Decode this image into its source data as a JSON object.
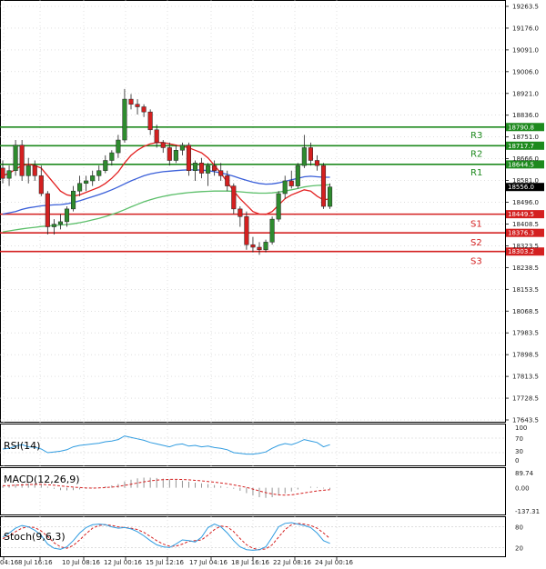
{
  "chart_data": {
    "type": "candlestick",
    "colors": {
      "up": "#2e8b2e",
      "down": "#d42020",
      "ma_fast": "#e32020",
      "ma_mid": "#3a5fd9",
      "ma_slow": "#5cbf6a",
      "support": "#d42020",
      "resistance": "#1e8a1e",
      "rsi": "#2e9be0",
      "macd_signal": "#d42020",
      "stoch_k": "#2e9be0",
      "stoch_d": "#d42020",
      "grid": "#cccccc"
    },
    "price_axis": {
      "ticks": [
        "19263.5",
        "19176.0",
        "19091.0",
        "19006.0",
        "18921.0",
        "18836.0",
        "18751.0",
        "18666.0",
        "18581.0",
        "18496.0",
        "18408.5",
        "18323.5",
        "18238.5",
        "18153.5",
        "18068.5",
        "17983.5",
        "17898.5",
        "17813.5",
        "17728.5",
        "17643.5"
      ],
      "range": [
        17643.5,
        19263.5
      ]
    },
    "x_axis": {
      "ticks": [
        "04:16",
        "8 Jul 16:16",
        "10 Jul 08:16",
        "12 Jul 00:16",
        "15 Jul 12:16",
        "17 Jul 04:16",
        "18 Jul 16:16",
        "22 Jul 08:16",
        "24 Jul 00:16"
      ]
    },
    "levels": [
      {
        "name": "R3",
        "value": 18790.8,
        "tag": "18790.8",
        "kind": "resistance"
      },
      {
        "name": "R2",
        "value": 18717.7,
        "tag": "18717.7",
        "kind": "resistance"
      },
      {
        "name": "R1",
        "value": 18644.5,
        "tag": "18644.5",
        "kind": "resistance"
      },
      {
        "name": "S1",
        "value": 18449.5,
        "tag": "18449.5",
        "kind": "support"
      },
      {
        "name": "S2",
        "value": 18376.3,
        "tag": "18376.3",
        "kind": "support"
      },
      {
        "name": "S3",
        "value": 18303.2,
        "tag": "18303.2",
        "kind": "support"
      }
    ],
    "current_price": {
      "value": 18556.0,
      "tag": "18556.0"
    },
    "candles": [
      {
        "o": 18630,
        "h": 18660,
        "l": 18570,
        "c": 18590
      },
      {
        "o": 18590,
        "h": 18640,
        "l": 18560,
        "c": 18620
      },
      {
        "o": 18620,
        "h": 18740,
        "l": 18600,
        "c": 18720
      },
      {
        "o": 18720,
        "h": 18740,
        "l": 18580,
        "c": 18600
      },
      {
        "o": 18600,
        "h": 18670,
        "l": 18570,
        "c": 18640
      },
      {
        "o": 18640,
        "h": 18660,
        "l": 18580,
        "c": 18600
      },
      {
        "o": 18600,
        "h": 18640,
        "l": 18520,
        "c": 18530
      },
      {
        "o": 18530,
        "h": 18540,
        "l": 18370,
        "c": 18400
      },
      {
        "o": 18400,
        "h": 18430,
        "l": 18370,
        "c": 18410
      },
      {
        "o": 18410,
        "h": 18450,
        "l": 18390,
        "c": 18420
      },
      {
        "o": 18420,
        "h": 18480,
        "l": 18400,
        "c": 18470
      },
      {
        "o": 18470,
        "h": 18560,
        "l": 18460,
        "c": 18540
      },
      {
        "o": 18540,
        "h": 18600,
        "l": 18520,
        "c": 18570
      },
      {
        "o": 18570,
        "h": 18600,
        "l": 18540,
        "c": 18580
      },
      {
        "o": 18580,
        "h": 18620,
        "l": 18560,
        "c": 18600
      },
      {
        "o": 18600,
        "h": 18640,
        "l": 18580,
        "c": 18620
      },
      {
        "o": 18620,
        "h": 18680,
        "l": 18610,
        "c": 18660
      },
      {
        "o": 18660,
        "h": 18700,
        "l": 18640,
        "c": 18690
      },
      {
        "o": 18690,
        "h": 18760,
        "l": 18670,
        "c": 18740
      },
      {
        "o": 18740,
        "h": 18940,
        "l": 18730,
        "c": 18900
      },
      {
        "o": 18900,
        "h": 18920,
        "l": 18860,
        "c": 18880
      },
      {
        "o": 18880,
        "h": 18900,
        "l": 18840,
        "c": 18870
      },
      {
        "o": 18870,
        "h": 18880,
        "l": 18830,
        "c": 18850
      },
      {
        "o": 18850,
        "h": 18860,
        "l": 18760,
        "c": 18780
      },
      {
        "o": 18780,
        "h": 18800,
        "l": 18710,
        "c": 18730
      },
      {
        "o": 18730,
        "h": 18740,
        "l": 18690,
        "c": 18710
      },
      {
        "o": 18710,
        "h": 18730,
        "l": 18640,
        "c": 18660
      },
      {
        "o": 18660,
        "h": 18720,
        "l": 18650,
        "c": 18700
      },
      {
        "o": 18700,
        "h": 18730,
        "l": 18680,
        "c": 18720
      },
      {
        "o": 18720,
        "h": 18730,
        "l": 18600,
        "c": 18620
      },
      {
        "o": 18620,
        "h": 18660,
        "l": 18580,
        "c": 18650
      },
      {
        "o": 18650,
        "h": 18670,
        "l": 18590,
        "c": 18610
      },
      {
        "o": 18610,
        "h": 18650,
        "l": 18560,
        "c": 18640
      },
      {
        "o": 18640,
        "h": 18660,
        "l": 18600,
        "c": 18620
      },
      {
        "o": 18620,
        "h": 18650,
        "l": 18580,
        "c": 18600
      },
      {
        "o": 18600,
        "h": 18620,
        "l": 18540,
        "c": 18560
      },
      {
        "o": 18560,
        "h": 18570,
        "l": 18450,
        "c": 18470
      },
      {
        "o": 18470,
        "h": 18480,
        "l": 18400,
        "c": 18440
      },
      {
        "o": 18440,
        "h": 18460,
        "l": 18310,
        "c": 18330
      },
      {
        "o": 18330,
        "h": 18360,
        "l": 18300,
        "c": 18320
      },
      {
        "o": 18320,
        "h": 18340,
        "l": 18290,
        "c": 18310
      },
      {
        "o": 18310,
        "h": 18350,
        "l": 18300,
        "c": 18340
      },
      {
        "o": 18340,
        "h": 18440,
        "l": 18330,
        "c": 18430
      },
      {
        "o": 18430,
        "h": 18540,
        "l": 18420,
        "c": 18530
      },
      {
        "o": 18530,
        "h": 18600,
        "l": 18510,
        "c": 18580
      },
      {
        "o": 18580,
        "h": 18620,
        "l": 18550,
        "c": 18560
      },
      {
        "o": 18560,
        "h": 18650,
        "l": 18550,
        "c": 18640
      },
      {
        "o": 18640,
        "h": 18760,
        "l": 18630,
        "c": 18710
      },
      {
        "o": 18710,
        "h": 18730,
        "l": 18640,
        "c": 18660
      },
      {
        "o": 18660,
        "h": 18680,
        "l": 18620,
        "c": 18640
      },
      {
        "o": 18640,
        "h": 18650,
        "l": 18470,
        "c": 18480
      },
      {
        "o": 18480,
        "h": 18570,
        "l": 18470,
        "c": 18556
      }
    ],
    "ma_fast": [
      18600,
      18610,
      18625,
      18640,
      18645,
      18640,
      18630,
      18600,
      18570,
      18540,
      18525,
      18520,
      18525,
      18535,
      18545,
      18555,
      18570,
      18590,
      18615,
      18650,
      18680,
      18700,
      18715,
      18725,
      18730,
      18730,
      18725,
      18720,
      18715,
      18710,
      18700,
      18690,
      18670,
      18640,
      18610,
      18575,
      18540,
      18510,
      18485,
      18460,
      18450,
      18448,
      18460,
      18485,
      18510,
      18525,
      18535,
      18545,
      18540,
      18520,
      18505,
      18510
    ],
    "ma_mid": [
      18450,
      18455,
      18460,
      18468,
      18474,
      18478,
      18482,
      18484,
      18486,
      18487,
      18490,
      18495,
      18502,
      18510,
      18518,
      18526,
      18535,
      18545,
      18556,
      18568,
      18580,
      18590,
      18600,
      18607,
      18612,
      18616,
      18618,
      18620,
      18622,
      18623,
      18623,
      18622,
      18620,
      18616,
      18611,
      18605,
      18598,
      18590,
      18582,
      18575,
      18570,
      18567,
      18568,
      18572,
      18578,
      18584,
      18590,
      18596,
      18598,
      18596,
      18594,
      18594
    ],
    "ma_slow": [
      18380,
      18384,
      18388,
      18392,
      18395,
      18398,
      18401,
      18403,
      18405,
      18407,
      18409,
      18412,
      18416,
      18421,
      18427,
      18433,
      18440,
      18448,
      18457,
      18467,
      18478,
      18488,
      18498,
      18506,
      18513,
      18519,
      18524,
      18528,
      18531,
      18534,
      18536,
      18538,
      18539,
      18540,
      18540,
      18540,
      18539,
      18537,
      18535,
      18533,
      18532,
      18532,
      18533,
      18536,
      18540,
      18545,
      18550,
      18556,
      18560,
      18562,
      18563,
      18565
    ],
    "rsi": {
      "label": "RSI(14)",
      "ticks": [
        "100",
        "70",
        "30",
        "0"
      ],
      "values": [
        40,
        42,
        48,
        52,
        46,
        45,
        40,
        30,
        32,
        34,
        38,
        46,
        50,
        52,
        54,
        56,
        60,
        62,
        66,
        76,
        72,
        68,
        64,
        58,
        54,
        50,
        46,
        52,
        54,
        48,
        50,
        46,
        48,
        44,
        42,
        38,
        30,
        28,
        26,
        26,
        28,
        32,
        42,
        50,
        55,
        52,
        58,
        66,
        62,
        58,
        46,
        52
      ]
    },
    "macd": {
      "label": "MACD(12,26,9)",
      "ticks": [
        "89.74",
        "0.00",
        "-137.31"
      ],
      "hist": [
        10,
        14,
        20,
        24,
        26,
        24,
        18,
        6,
        -6,
        -14,
        -16,
        -14,
        -10,
        -6,
        -2,
        2,
        8,
        14,
        22,
        38,
        48,
        56,
        60,
        60,
        58,
        54,
        50,
        46,
        42,
        36,
        30,
        26,
        22,
        16,
        10,
        4,
        -6,
        -18,
        -32,
        -46,
        -56,
        -60,
        -56,
        -46,
        -34,
        -22,
        -10,
        0,
        6,
        4,
        -4,
        -8
      ],
      "signal": [
        12,
        13,
        15,
        17,
        19,
        20,
        20,
        18,
        15,
        11,
        7,
        4,
        1,
        -1,
        -2,
        -1,
        1,
        4,
        8,
        14,
        21,
        28,
        35,
        41,
        45,
        48,
        50,
        50,
        49,
        47,
        44,
        41,
        37,
        33,
        28,
        23,
        17,
        10,
        2,
        -8,
        -19,
        -29,
        -37,
        -42,
        -44,
        -42,
        -37,
        -31,
        -25,
        -19,
        -15,
        -12
      ]
    },
    "stoch": {
      "label": "Stoch(9,6,3)",
      "ticks": [
        "80",
        "20"
      ],
      "k": [
        50,
        62,
        76,
        84,
        80,
        70,
        55,
        30,
        18,
        15,
        22,
        40,
        62,
        78,
        86,
        88,
        86,
        80,
        76,
        78,
        74,
        66,
        54,
        40,
        28,
        22,
        20,
        30,
        42,
        40,
        36,
        50,
        78,
        88,
        80,
        62,
        40,
        22,
        14,
        12,
        14,
        22,
        50,
        80,
        90,
        92,
        88,
        84,
        78,
        62,
        40,
        32
      ],
      "d": [
        46,
        54,
        66,
        76,
        80,
        78,
        68,
        52,
        34,
        22,
        18,
        26,
        42,
        60,
        76,
        84,
        86,
        84,
        80,
        78,
        76,
        72,
        64,
        52,
        40,
        30,
        24,
        24,
        30,
        38,
        40,
        42,
        56,
        72,
        82,
        80,
        66,
        46,
        28,
        18,
        14,
        16,
        28,
        50,
        72,
        86,
        90,
        88,
        84,
        76,
        62,
        46
      ]
    }
  }
}
